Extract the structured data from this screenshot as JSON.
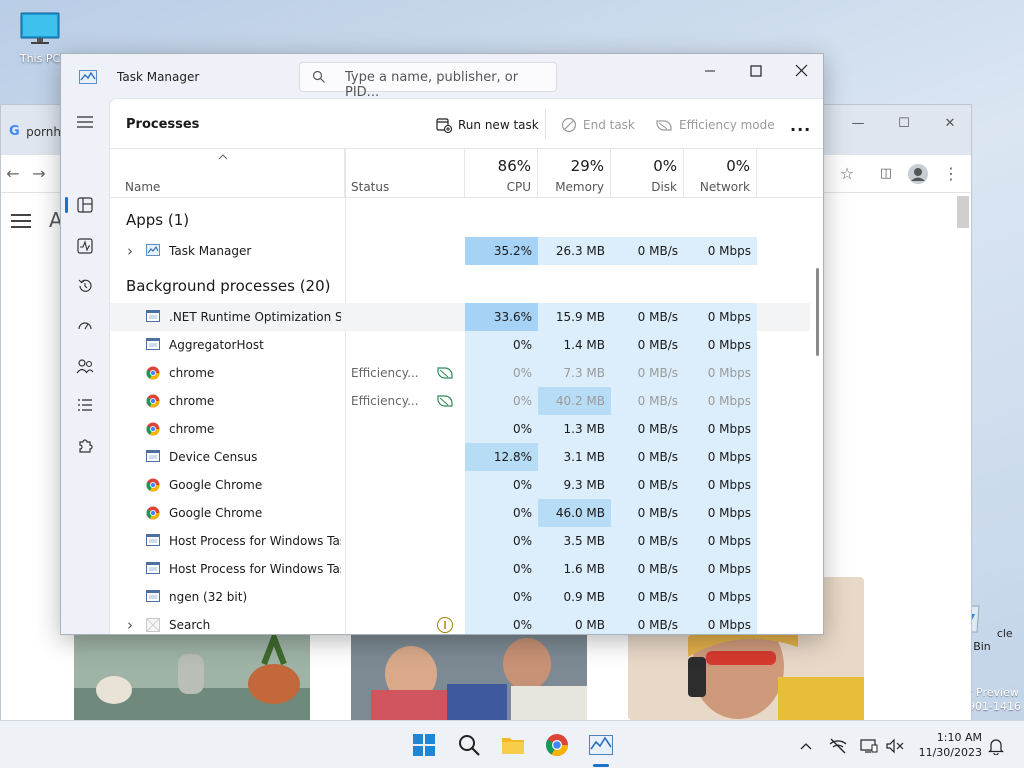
{
  "desktop": {
    "icons": [
      {
        "label": "This PC"
      },
      {
        "label": "cle Bin"
      }
    ],
    "watermark": {
      "line1": "r Preview",
      "line2": "901-1416"
    }
  },
  "browser": {
    "tab_title": "pornh",
    "page_letter": "A"
  },
  "task_manager": {
    "title": "Task Manager",
    "search_placeholder": "Type a name, publisher, or PID...",
    "page_title": "Processes",
    "toolbar": {
      "run_new_task": "Run new task",
      "end_task": "End task",
      "efficiency_mode": "Efficiency mode",
      "more": "..."
    },
    "columns": {
      "name": "Name",
      "status": "Status",
      "cpu": {
        "pct": "86%",
        "label": "CPU"
      },
      "memory": {
        "pct": "29%",
        "label": "Memory"
      },
      "disk": {
        "pct": "0%",
        "label": "Disk"
      },
      "network": {
        "pct": "0%",
        "label": "Network"
      }
    },
    "groups": {
      "apps": "Apps (1)",
      "background": "Background processes (20)"
    },
    "apps": [
      {
        "name": "Task Manager",
        "status": "",
        "cpu": "35.2%",
        "memory": "26.3 MB",
        "disk": "0 MB/s",
        "network": "0 Mbps",
        "icon": "task-manager-icon",
        "expandable": true
      }
    ],
    "background": [
      {
        "name": ".NET Runtime Optimization Se...",
        "status": "",
        "cpu": "33.6%",
        "memory": "15.9 MB",
        "disk": "0 MB/s",
        "network": "0 Mbps",
        "icon": "process-icon"
      },
      {
        "name": "AggregatorHost",
        "status": "",
        "cpu": "0%",
        "memory": "1.4 MB",
        "disk": "0 MB/s",
        "network": "0 Mbps",
        "icon": "process-icon"
      },
      {
        "name": "chrome",
        "status": "Efficiency...",
        "cpu": "0%",
        "memory": "7.3 MB",
        "disk": "0 MB/s",
        "network": "0 Mbps",
        "icon": "chrome-icon",
        "efficiency": true
      },
      {
        "name": "chrome",
        "status": "Efficiency...",
        "cpu": "0%",
        "memory": "40.2 MB",
        "disk": "0 MB/s",
        "network": "0 Mbps",
        "icon": "chrome-icon",
        "efficiency": true
      },
      {
        "name": "chrome",
        "status": "",
        "cpu": "0%",
        "memory": "1.3 MB",
        "disk": "0 MB/s",
        "network": "0 Mbps",
        "icon": "chrome-icon"
      },
      {
        "name": "Device Census",
        "status": "",
        "cpu": "12.8%",
        "memory": "3.1 MB",
        "disk": "0 MB/s",
        "network": "0 Mbps",
        "icon": "process-icon"
      },
      {
        "name": "Google Chrome",
        "status": "",
        "cpu": "0%",
        "memory": "9.3 MB",
        "disk": "0 MB/s",
        "network": "0 Mbps",
        "icon": "chrome-icon"
      },
      {
        "name": "Google Chrome",
        "status": "",
        "cpu": "0%",
        "memory": "46.0 MB",
        "disk": "0 MB/s",
        "network": "0 Mbps",
        "icon": "chrome-icon"
      },
      {
        "name": "Host Process for Windows Tasks",
        "status": "",
        "cpu": "0%",
        "memory": "3.5 MB",
        "disk": "0 MB/s",
        "network": "0 Mbps",
        "icon": "process-icon"
      },
      {
        "name": "Host Process for Windows Tasks",
        "status": "",
        "cpu": "0%",
        "memory": "1.6 MB",
        "disk": "0 MB/s",
        "network": "0 Mbps",
        "icon": "process-icon"
      },
      {
        "name": "ngen (32 bit)",
        "status": "",
        "cpu": "0%",
        "memory": "0.9 MB",
        "disk": "0 MB/s",
        "network": "0 Mbps",
        "icon": "process-icon"
      },
      {
        "name": "Search",
        "status": "",
        "cpu": "0%",
        "memory": "0 MB",
        "disk": "0 MB/s",
        "network": "0 Mbps",
        "icon": "search-app-icon",
        "expandable": true,
        "suspended": true
      }
    ],
    "colors": {
      "heat_low": "#dcedfb",
      "heat_mid": "#b7dcf6",
      "heat_high": "#a6d3f5",
      "accent": "#1a73c8"
    }
  },
  "taskbar": {
    "clock_time": "1:10 AM",
    "clock_date": "11/30/2023"
  }
}
